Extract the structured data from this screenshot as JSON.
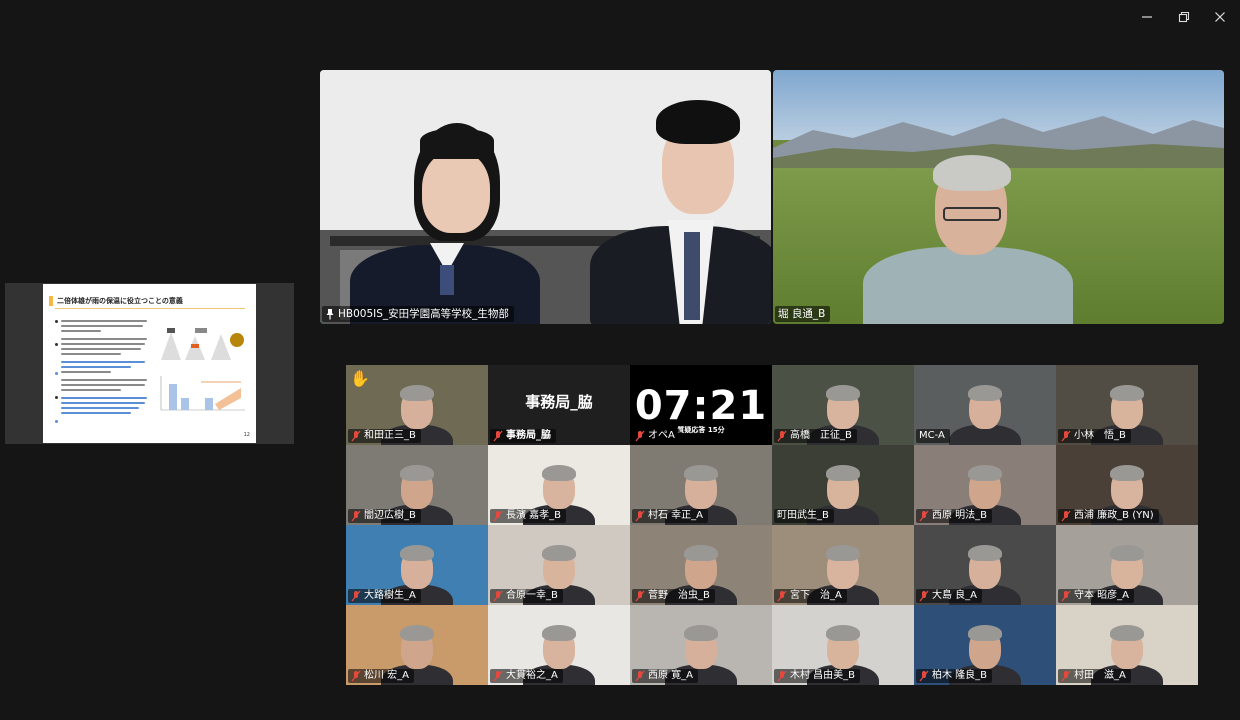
{
  "window": {
    "controls": {
      "minimize": "minimize",
      "restore": "restore",
      "close": "close"
    }
  },
  "share": {
    "slide_title": "二倍体雄が雨の保温に役立つことの意義",
    "page_number": "12"
  },
  "speakers": {
    "main": {
      "label": "HB005IS_安田学園高等学校_生物部",
      "pinned": true
    },
    "second": {
      "label": "堀 良通_B"
    }
  },
  "clock": {
    "time": "07:21",
    "caption": "質疑応答 15分"
  },
  "namecard": {
    "text": "事務局_脇"
  },
  "participants": [
    {
      "name": "和田正三_B",
      "muted": true,
      "hand": true
    },
    {
      "name": "事務局_脇",
      "muted": true
    },
    {
      "name": "オペA",
      "muted": true
    },
    {
      "name": "高橋　正征_B",
      "muted": true
    },
    {
      "name": "MC-A",
      "muted": false
    },
    {
      "name": "小林　悟_B",
      "muted": true
    },
    {
      "name": "闇辺広樹_B",
      "muted": true
    },
    {
      "name": "長濱 嘉孝_B",
      "muted": true
    },
    {
      "name": "村石 幸正_A",
      "muted": true
    },
    {
      "name": "町田武生_B",
      "muted": false
    },
    {
      "name": "西原 明法_B",
      "muted": true
    },
    {
      "name": "西浦 廉政_B (YN)",
      "muted": true
    },
    {
      "name": "大路樹生_A",
      "muted": true
    },
    {
      "name": "合原一幸_B",
      "muted": true
    },
    {
      "name": "菅野　治虫_B",
      "muted": true
    },
    {
      "name": "宮下　治_A",
      "muted": true
    },
    {
      "name": "大島 良_A",
      "muted": true
    },
    {
      "name": "守本 昭彦_A",
      "muted": true
    },
    {
      "name": "松川 宏_A",
      "muted": true
    },
    {
      "name": "大貫裕之_A",
      "muted": true
    },
    {
      "name": "西原 寛_A",
      "muted": true
    },
    {
      "name": "木村 昌由美_B",
      "muted": true
    },
    {
      "name": "柏木 隆良_B",
      "muted": true
    },
    {
      "name": "村田　滋_A",
      "muted": true
    }
  ],
  "colors": {
    "speaking_border": "#23d160",
    "mute_icon": "#e5483d",
    "background": "#151515"
  }
}
